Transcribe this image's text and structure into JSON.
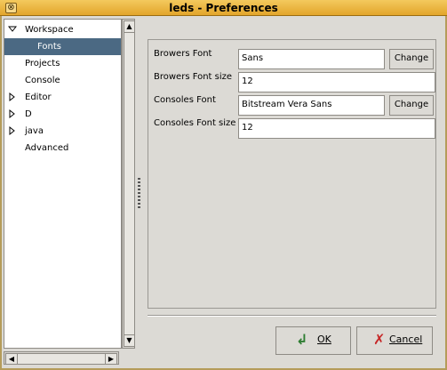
{
  "window": {
    "title": "leds - Preferences",
    "close_glyph": "⊗"
  },
  "tree": {
    "items": [
      {
        "label": "Workspace",
        "expanded": true,
        "has_children": true,
        "selected": false,
        "level": 0
      },
      {
        "label": "Fonts",
        "expanded": false,
        "has_children": false,
        "selected": true,
        "level": 1
      },
      {
        "label": "Projects",
        "expanded": false,
        "has_children": false,
        "selected": false,
        "level": 0
      },
      {
        "label": "Console",
        "expanded": false,
        "has_children": false,
        "selected": false,
        "level": 0
      },
      {
        "label": "Editor",
        "expanded": false,
        "has_children": true,
        "selected": false,
        "level": 0
      },
      {
        "label": "D",
        "expanded": false,
        "has_children": true,
        "selected": false,
        "level": 0
      },
      {
        "label": "java",
        "expanded": false,
        "has_children": true,
        "selected": false,
        "level": 0
      },
      {
        "label": "Advanced",
        "expanded": false,
        "has_children": false,
        "selected": false,
        "level": 0
      }
    ]
  },
  "form": {
    "browsers_font_label": "Browers Font",
    "browsers_font_value": "Sans",
    "browsers_font_size_label": "Browers Font size",
    "browsers_font_size_value": "12",
    "consoles_font_label": "Consoles Font",
    "consoles_font_value": "Bitstream Vera Sans",
    "consoles_font_size_label": "Consoles Font size",
    "consoles_font_size_value": "12",
    "change_label": "Change"
  },
  "buttons": {
    "ok_label": "OK",
    "cancel_label": "Cancel"
  },
  "colors": {
    "title_bar": "#e3a52b",
    "selection": "#4b6983",
    "window_bg": "#dcdad5"
  },
  "icons": {
    "ok": "checkmark-arrow-icon",
    "cancel": "x-cross-icon"
  }
}
